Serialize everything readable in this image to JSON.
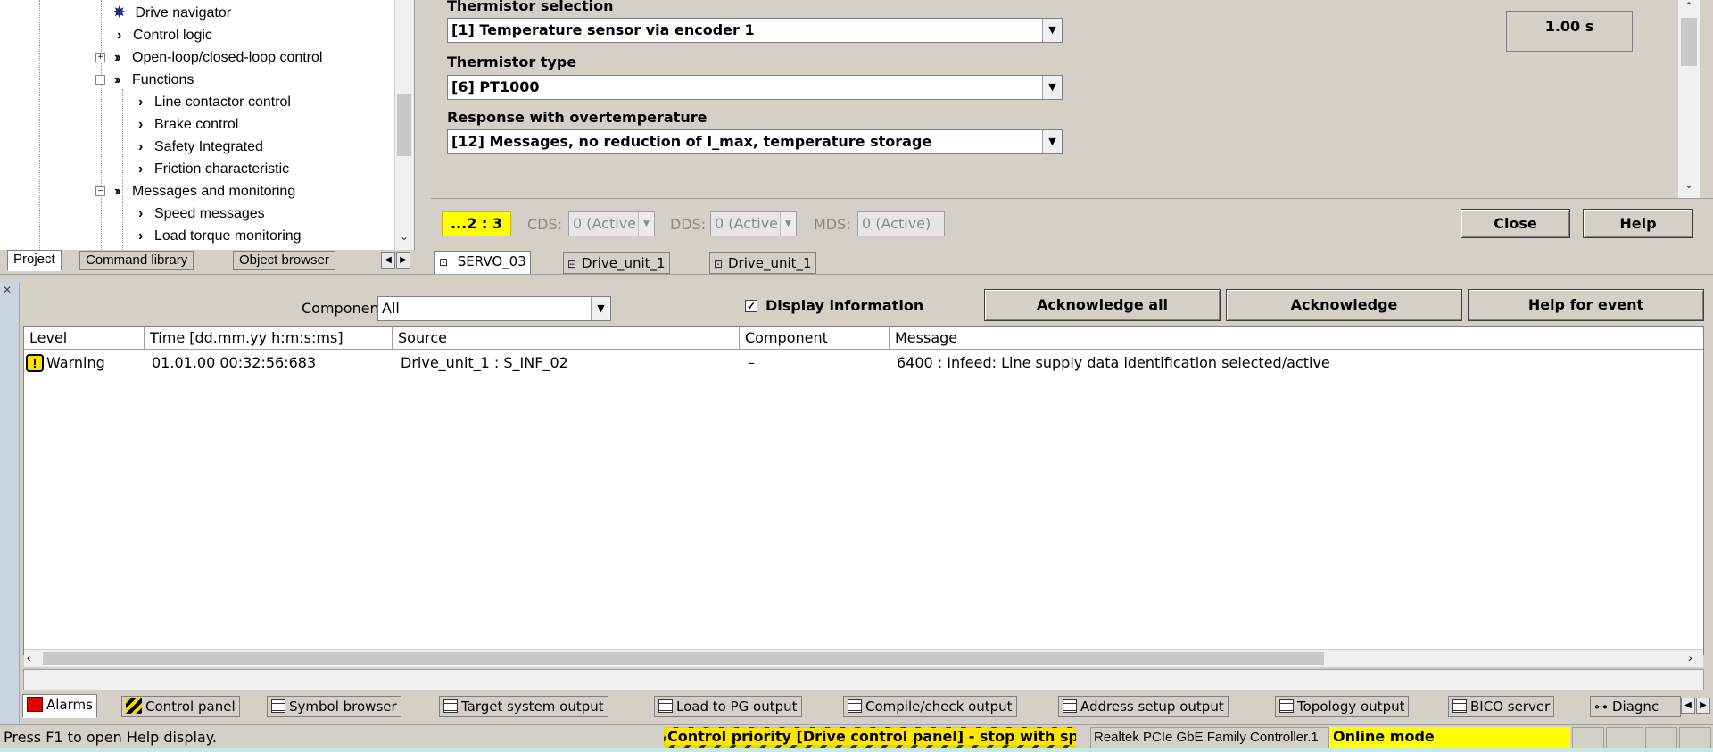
{
  "tree": {
    "items": [
      {
        "label": "Drive navigator"
      },
      {
        "label": "Control logic"
      },
      {
        "label": "Open-loop/closed-loop control"
      },
      {
        "label": "Functions"
      },
      {
        "label": "Line contactor control"
      },
      {
        "label": "Brake control"
      },
      {
        "label": "Safety Integrated"
      },
      {
        "label": "Friction characteristic"
      },
      {
        "label": "Messages and monitoring"
      },
      {
        "label": "Speed messages"
      },
      {
        "label": "Load torque monitoring"
      }
    ]
  },
  "left_tabs": {
    "project": "Project",
    "command_library": "Command library",
    "object_browser": "Object browser"
  },
  "dialog": {
    "thermistor_selection_label": "Thermistor selection",
    "thermistor_selection_value": "[1] Temperature sensor via encoder 1",
    "thermistor_type_label": "Thermistor type",
    "thermistor_type_value": "[6] PT1000",
    "response_label": "Response with overtemperature",
    "response_value": "[12] Messages, no reduction of I_max, temperature storage",
    "time_value": "1.00 s",
    "mds_badge": "...2 : 3",
    "cds_label": "CDS:",
    "cds_value": "0 (Active",
    "dds_label": "DDS:",
    "dds_value": "0 (Active",
    "mds_label": "MDS:",
    "mds_value": "0 (Active)",
    "close_button": "Close",
    "help_button": "Help"
  },
  "editor_tabs": [
    {
      "label": "SERVO_03"
    },
    {
      "label": "Drive_unit_1"
    },
    {
      "label": "Drive_unit_1"
    }
  ],
  "alarms": {
    "component_label": "Componen",
    "component_value": "All",
    "display_information": "Display information",
    "acknowledge_all": "Acknowledge all",
    "acknowledge": "Acknowledge",
    "help_for_event": "Help for event",
    "columns": [
      "Level",
      "Time [dd.mm.yy  h:m:s:ms]",
      "Source",
      "Component",
      "Message"
    ],
    "rows": [
      {
        "level": "Warning",
        "time": "01.01.00   00:32:56:683",
        "source": "Drive_unit_1 : S_INF_02",
        "component": "–",
        "message": "6400 : Infeed: Line supply data identification selected/active"
      }
    ]
  },
  "bottom_tabs": [
    {
      "label": "Alarms"
    },
    {
      "label": "Control panel"
    },
    {
      "label": "Symbol browser"
    },
    {
      "label": "Target system output"
    },
    {
      "label": "Load to PG output"
    },
    {
      "label": "Compile/check output"
    },
    {
      "label": "Address setup output"
    },
    {
      "label": "Topology output"
    },
    {
      "label": "BICO server"
    },
    {
      "label": "Diagnc"
    }
  ],
  "status": {
    "help_text": "Press F1 to open Help display.",
    "priority_text": "Control priority [Drive control panel] - stop with spacebar",
    "network_controller": "Realtek PCIe GbE Family Controller.1",
    "online_mode": "Online mode"
  },
  "colors": {
    "highlight_yellow": "#ffff00",
    "warning_yellow": "#ffe000",
    "panel_gray": "#d4d0c8"
  }
}
